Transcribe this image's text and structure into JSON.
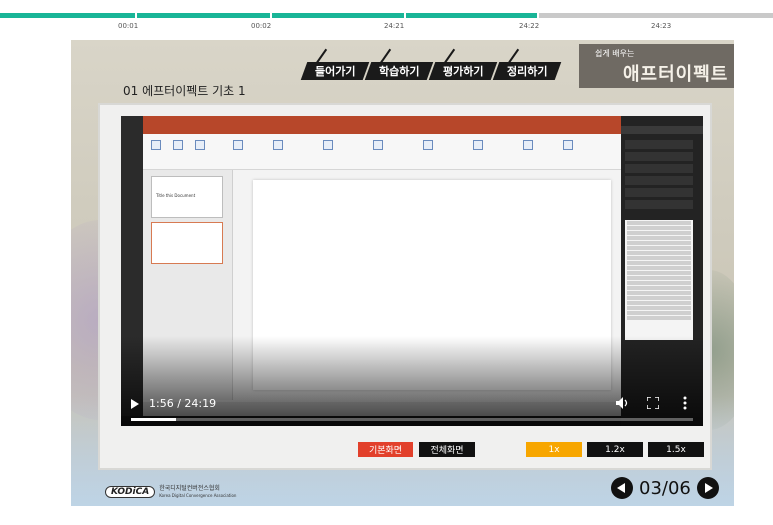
{
  "timeline": {
    "segments": [
      {
        "time": "00:01",
        "color": "#19b597"
      },
      {
        "time": "00:02",
        "color": "#19b597"
      },
      {
        "time": "24:21",
        "color": "#19b597"
      },
      {
        "time": "24:22",
        "color": "#19b597"
      },
      {
        "time": "24:23",
        "color": "#c9c9c9"
      }
    ]
  },
  "nav": {
    "tabs": [
      "들어가기",
      "학습하기",
      "평가하기",
      "정리하기"
    ]
  },
  "brand": {
    "small": "쉽게 배우는",
    "big": "애프터이펙트"
  },
  "lesson": {
    "title": "01 에프터이펙트 기초 1"
  },
  "video": {
    "time": "1:56 / 24:19",
    "progress": 0.08,
    "slide_thumb_text": "Title this Document"
  },
  "controls": {
    "basic_view": "기본화면",
    "full_view": "전체화면",
    "speeds": [
      "1x",
      "1.2x",
      "1.5x"
    ],
    "active_speed_color": "#f7a600",
    "basic_color": "#e2402b"
  },
  "footer": {
    "org_logo": "KODiCA",
    "org_name": "한국디지털컨버전스협회",
    "org_name_en": "Korea Digital Convergence Association",
    "page": "03/06"
  }
}
